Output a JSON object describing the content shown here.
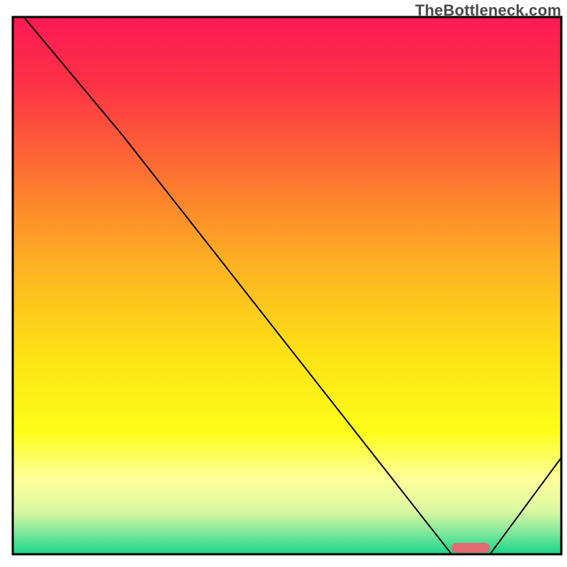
{
  "watermark": "TheBottleneck.com",
  "chart_data": {
    "type": "line",
    "title": "",
    "xlabel": "",
    "ylabel": "",
    "xlim": [
      0,
      100
    ],
    "ylim": [
      0,
      100
    ],
    "x": [
      2,
      20,
      80,
      87,
      100
    ],
    "y": [
      100,
      78,
      0,
      0,
      18
    ],
    "line_color": "#000000",
    "line_width": 2,
    "background_gradient": {
      "orientation": "vertical",
      "stops": [
        {
          "offset": 0.0,
          "color": "#fc1a54"
        },
        {
          "offset": 0.12,
          "color": "#fd3046"
        },
        {
          "offset": 0.28,
          "color": "#fd6d32"
        },
        {
          "offset": 0.45,
          "color": "#fdae23"
        },
        {
          "offset": 0.62,
          "color": "#fde016"
        },
        {
          "offset": 0.77,
          "color": "#fdfd17"
        },
        {
          "offset": 0.86,
          "color": "#ffff9c"
        },
        {
          "offset": 0.92,
          "color": "#daf8a0"
        },
        {
          "offset": 0.96,
          "color": "#7fe89b"
        },
        {
          "offset": 1.0,
          "color": "#17d58a"
        }
      ]
    },
    "axis_color": "#000000",
    "marker": {
      "x_center": 83.5,
      "width": 7,
      "color": "#e26a71"
    }
  }
}
